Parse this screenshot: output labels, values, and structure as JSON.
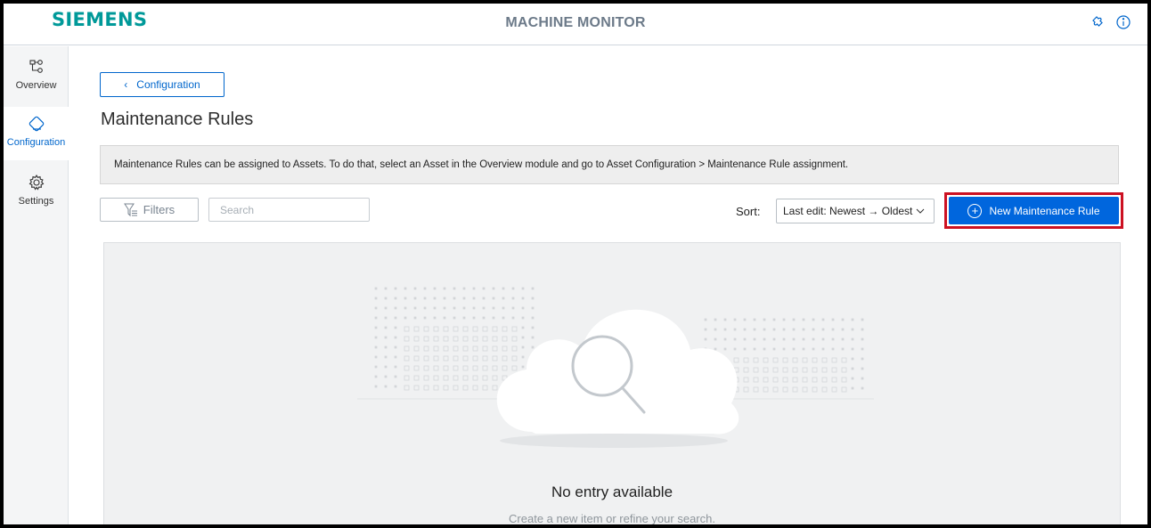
{
  "header": {
    "logo": "SIEMENS",
    "app_title": "MACHINE MONITOR",
    "icons": [
      "puzzle-icon",
      "info-icon"
    ]
  },
  "sidebar": {
    "items": [
      {
        "label": "Overview",
        "icon": "overview-icon",
        "active": false
      },
      {
        "label": "Configuration",
        "icon": "configuration-icon",
        "active": true
      },
      {
        "label": "Settings",
        "icon": "gear-icon",
        "active": false
      }
    ]
  },
  "main": {
    "back_button": "Configuration",
    "title": "Maintenance Rules",
    "info_text": "Maintenance Rules can be assigned to Assets. To do that, select an Asset in the Overview module and go to Asset Configuration > Maintenance Rule assignment.",
    "filters_label": "Filters",
    "search_placeholder": "Search",
    "sort_label": "Sort:",
    "sort_value": "Last edit: Newest → Oldest",
    "new_button": "New Maintenance Rule",
    "empty_title": "No entry available",
    "empty_subtitle": "Create a new item or refine your search."
  },
  "colors": {
    "brand": "#009999",
    "primary": "#0066dd",
    "highlight": "#cc1122"
  }
}
